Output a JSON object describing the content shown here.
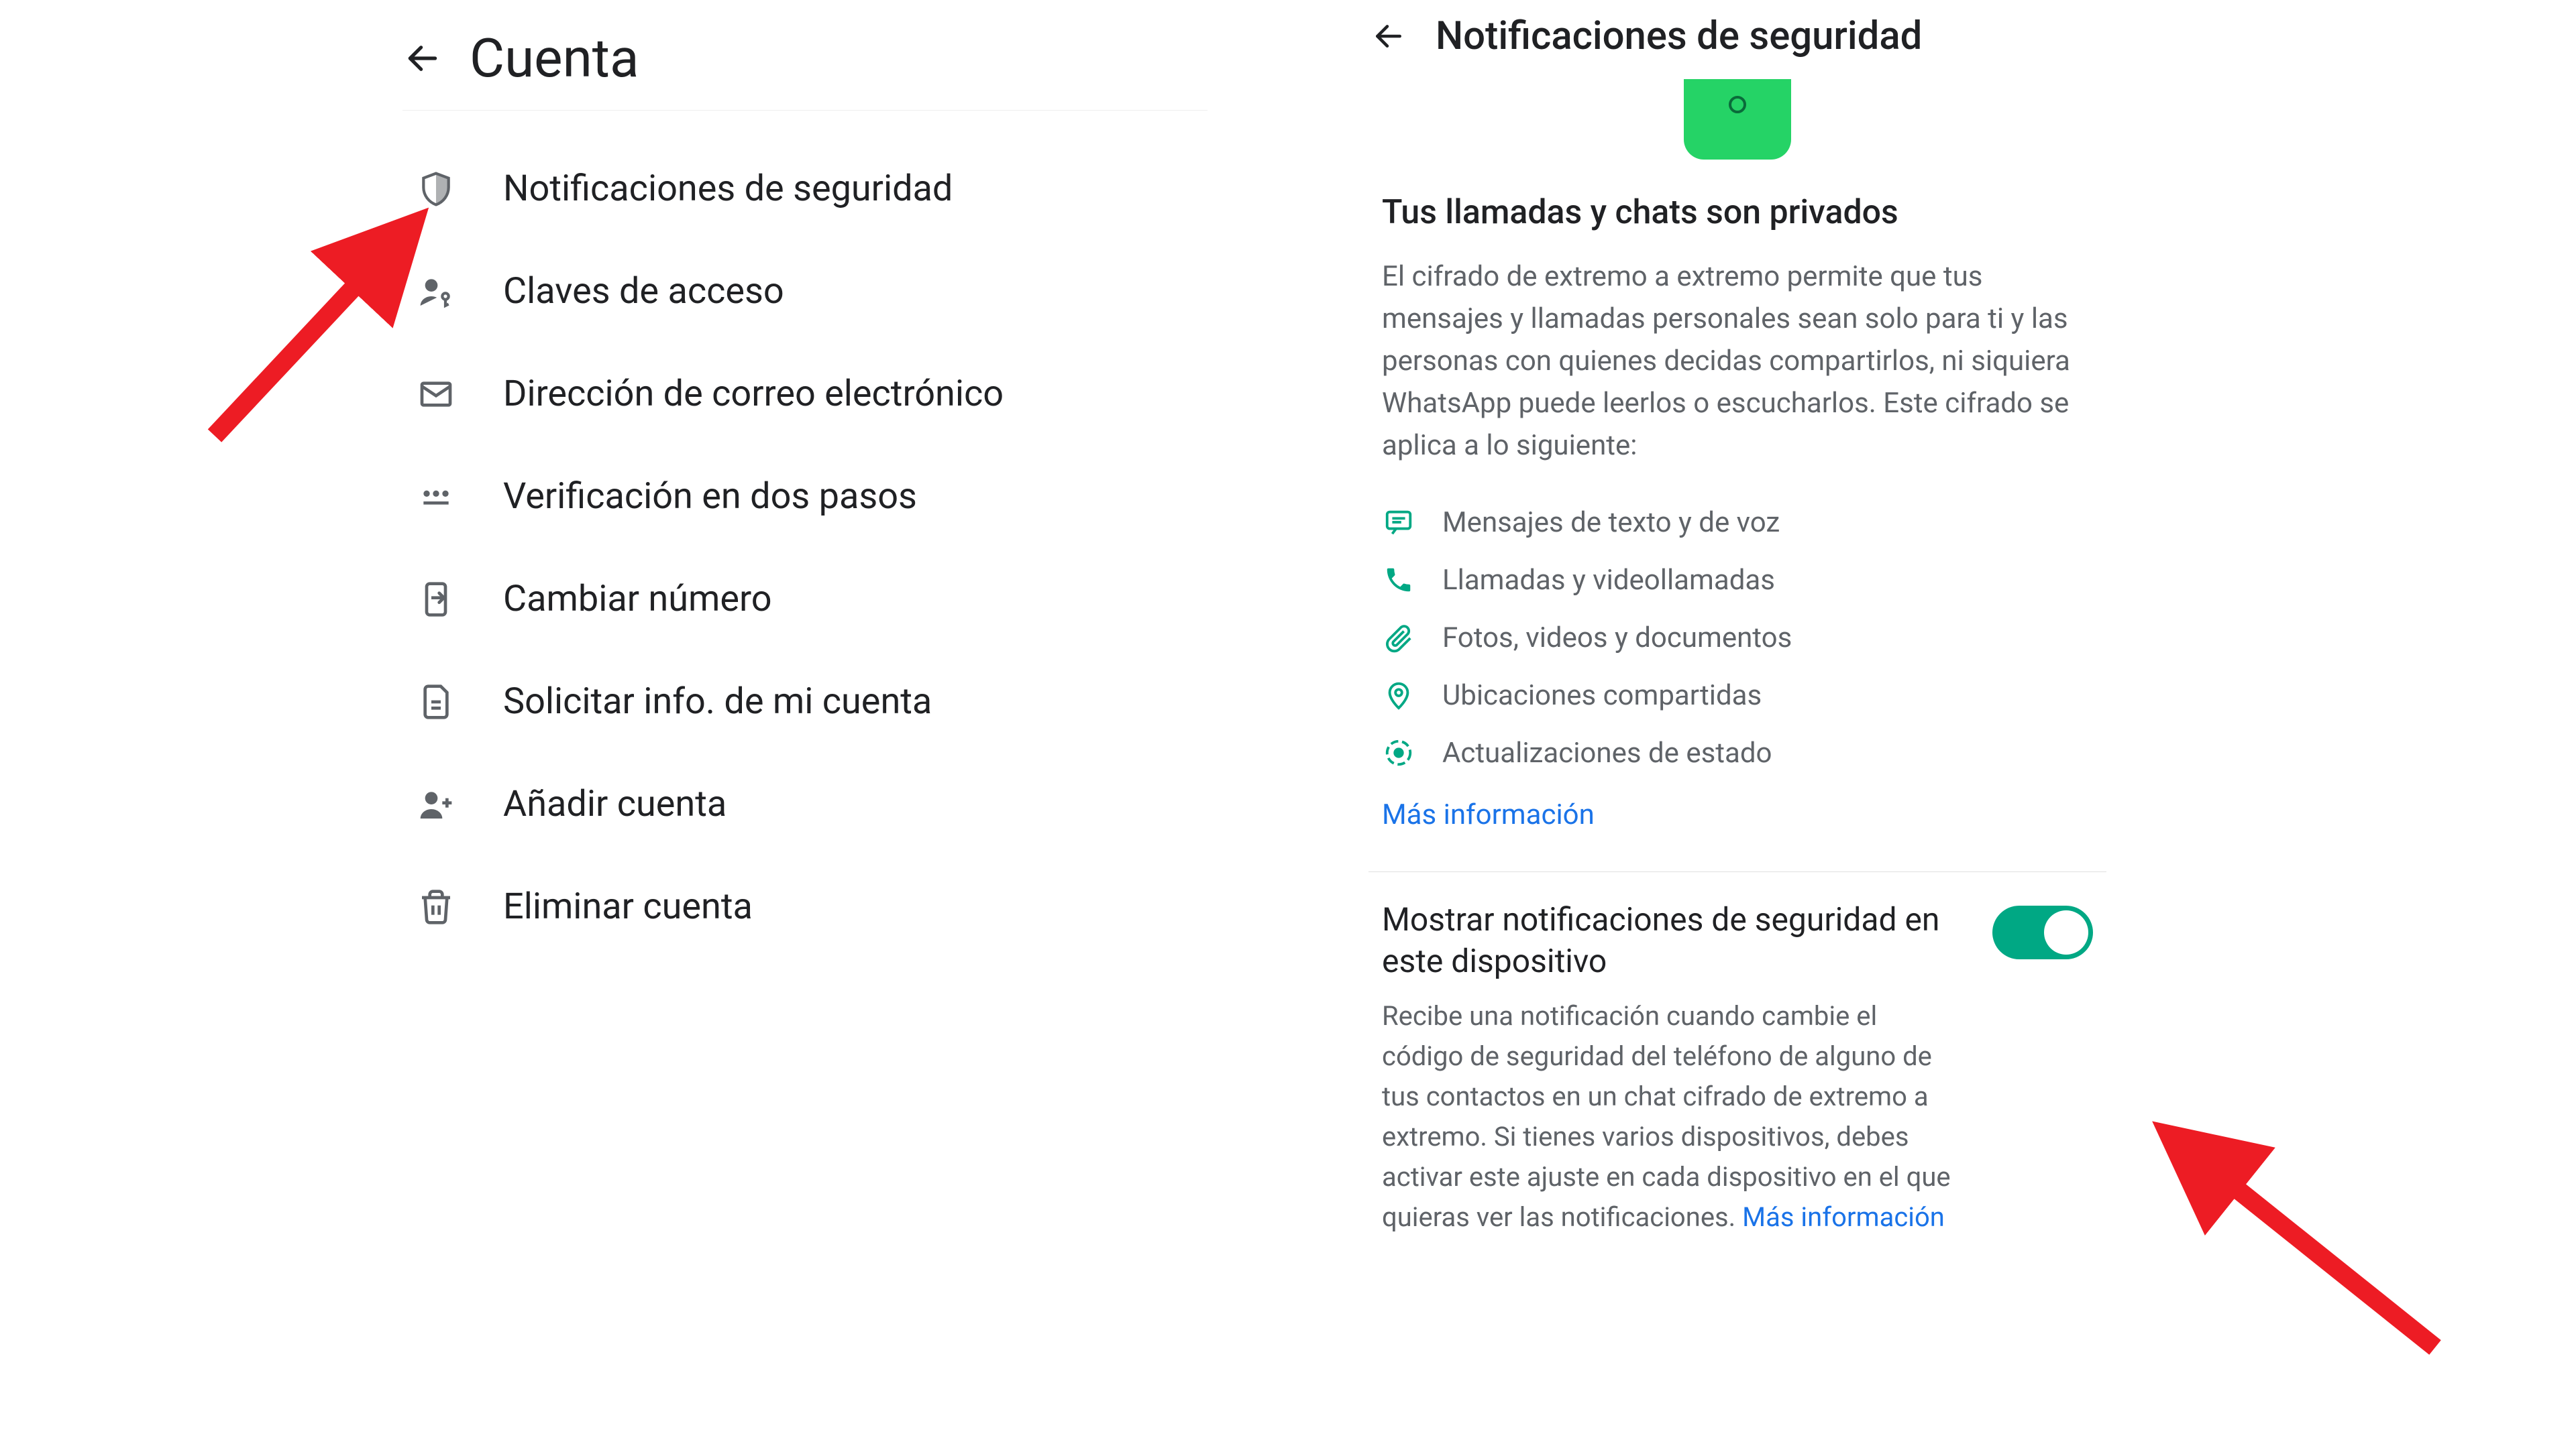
{
  "left": {
    "title": "Cuenta",
    "items": [
      {
        "label": "Notificaciones de seguridad",
        "icon": "shield"
      },
      {
        "label": "Claves de acceso",
        "icon": "key-person"
      },
      {
        "label": "Dirección de correo electrónico",
        "icon": "mail"
      },
      {
        "label": "Verificación en dos pasos",
        "icon": "dots"
      },
      {
        "label": "Cambiar número",
        "icon": "phone-swap"
      },
      {
        "label": "Solicitar info. de mi cuenta",
        "icon": "doc"
      },
      {
        "label": "Añadir cuenta",
        "icon": "person-add"
      },
      {
        "label": "Eliminar cuenta",
        "icon": "trash"
      }
    ]
  },
  "right": {
    "title": "Notificaciones de seguridad",
    "privacy_heading": "Tus llamadas y chats son privados",
    "privacy_body": "El cifrado de extremo a extremo permite que tus mensajes y llamadas personales sean solo para ti y las personas con quienes decidas compartirlos, ni siquiera WhatsApp puede leerlos o escucharlos. Este cifrado se aplica a lo siguiente:",
    "features": [
      {
        "label": "Mensajes de texto y de voz",
        "icon": "chat"
      },
      {
        "label": "Llamadas y videollamadas",
        "icon": "phone"
      },
      {
        "label": "Fotos, videos y documentos",
        "icon": "attach"
      },
      {
        "label": "Ubicaciones compartidas",
        "icon": "pin"
      },
      {
        "label": "Actualizaciones de estado",
        "icon": "status"
      }
    ],
    "more_link": "Más información",
    "toggle": {
      "title": "Mostrar notificaciones de seguridad en este dispositivo",
      "desc": "Recibe una notificación cuando cambie el código de seguridad del teléfono de alguno de tus contactos en un chat cifrado de extremo a extremo. Si tienes varios dispositivos, debes activar este ajuste en cada dispositivo en el que quieras ver las notificaciones. ",
      "link": "Más información",
      "enabled": true
    }
  },
  "colors": {
    "arrow": "#ed1c24",
    "green": "#25D366",
    "accent": "#00a884",
    "link": "#1a73e8"
  }
}
